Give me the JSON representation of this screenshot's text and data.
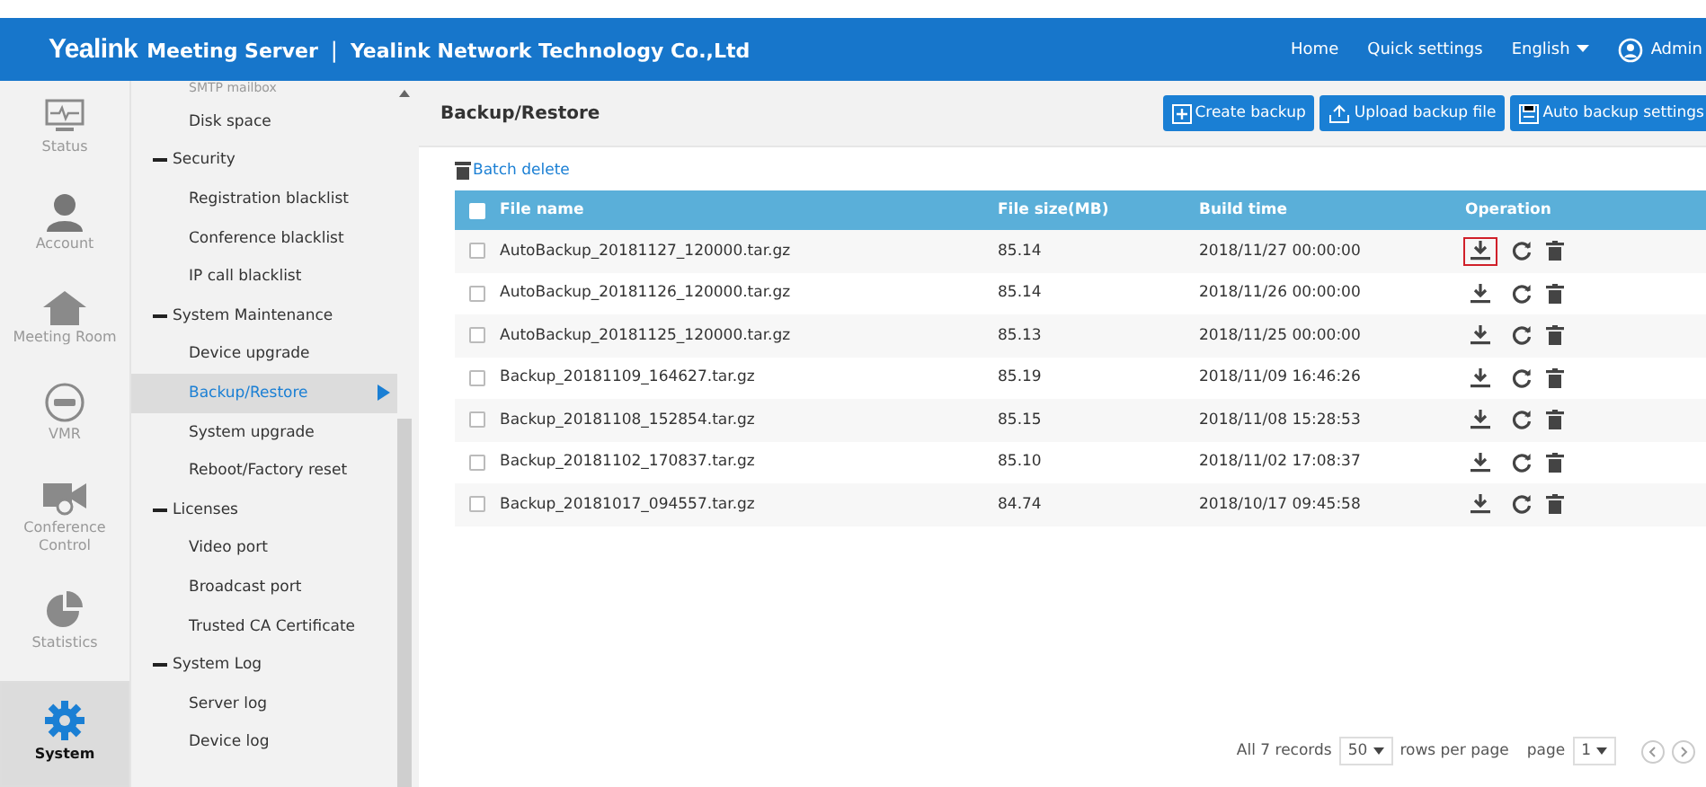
{
  "header": {
    "logo": "Yealink",
    "product": "Meeting Server",
    "separator": "|",
    "company": "Yealink Network Technology Co.,Ltd",
    "links": [
      "Home",
      "Quick settings"
    ],
    "language": "English",
    "user": "Admin"
  },
  "rail": [
    {
      "label": "Status",
      "kind": "monitor",
      "selected": false
    },
    {
      "label": "Account",
      "kind": "person",
      "selected": false
    },
    {
      "label": "Meeting Room",
      "kind": "house",
      "selected": false
    },
    {
      "label": "VMR",
      "kind": "vmr",
      "selected": false
    },
    {
      "label": "Conference Control",
      "kind": "camera",
      "selected": false
    },
    {
      "label": "Statistics",
      "kind": "pie",
      "selected": false
    },
    {
      "label": "System",
      "kind": "gear",
      "selected": true
    }
  ],
  "menu": [
    {
      "kind": "item",
      "label": "SMTP mailbox",
      "selected": false
    },
    {
      "kind": "item",
      "label": "Disk space",
      "selected": false
    },
    {
      "kind": "group",
      "label": "Security",
      "expanded": true
    },
    {
      "kind": "item",
      "label": "Registration blacklist",
      "selected": false
    },
    {
      "kind": "item",
      "label": "Conference blacklist",
      "selected": false
    },
    {
      "kind": "item",
      "label": "IP call blacklist",
      "selected": false
    },
    {
      "kind": "group",
      "label": "System Maintenance",
      "expanded": true
    },
    {
      "kind": "item",
      "label": "Device upgrade",
      "selected": false
    },
    {
      "kind": "item",
      "label": "Backup/Restore",
      "selected": true
    },
    {
      "kind": "item",
      "label": "System upgrade",
      "selected": false
    },
    {
      "kind": "item",
      "label": "Reboot/Factory reset",
      "selected": false
    },
    {
      "kind": "group",
      "label": "Licenses",
      "expanded": true
    },
    {
      "kind": "item",
      "label": "Video port",
      "selected": false
    },
    {
      "kind": "item",
      "label": "Broadcast port",
      "selected": false
    },
    {
      "kind": "item",
      "label": "Trusted CA Certificate",
      "selected": false
    },
    {
      "kind": "group",
      "label": "System Log",
      "expanded": true
    },
    {
      "kind": "item",
      "label": "Server log",
      "selected": false
    },
    {
      "kind": "item",
      "label": "Device log",
      "selected": false
    }
  ],
  "page": {
    "title": "Backup/Restore",
    "buttons": [
      {
        "label": "Create backup",
        "kind": "create"
      },
      {
        "label": "Upload backup file",
        "kind": "upload"
      },
      {
        "label": "Auto backup settings",
        "kind": "settings"
      }
    ],
    "batch_delete": "Batch delete"
  },
  "table": {
    "columns": [
      "File name",
      "File size(MB)",
      "Build time",
      "Operation"
    ],
    "header_checked": false,
    "rows": [
      {
        "name": "AutoBackup_20181127_120000.tar.gz",
        "size": "85.14",
        "time": "2018/11/27 00:00:00",
        "checked": false,
        "highlighted": true
      },
      {
        "name": "AutoBackup_20181126_120000.tar.gz",
        "size": "85.14",
        "time": "2018/11/26 00:00:00",
        "checked": false,
        "highlighted": false
      },
      {
        "name": "AutoBackup_20181125_120000.tar.gz",
        "size": "85.13",
        "time": "2018/11/25 00:00:00",
        "checked": false,
        "highlighted": false
      },
      {
        "name": "Backup_20181109_164627.tar.gz",
        "size": "85.19",
        "time": "2018/11/09 16:46:26",
        "checked": false,
        "highlighted": false
      },
      {
        "name": "Backup_20181108_152854.tar.gz",
        "size": "85.15",
        "time": "2018/11/08 15:28:53",
        "checked": false,
        "highlighted": false
      },
      {
        "name": "Backup_20181102_170837.tar.gz",
        "size": "85.10",
        "time": "2018/11/02 17:08:37",
        "checked": false,
        "highlighted": false
      },
      {
        "name": "Backup_20181017_094557.tar.gz",
        "size": "84.74",
        "time": "2018/10/17 09:45:58",
        "checked": false,
        "highlighted": false
      }
    ]
  },
  "pagination": {
    "total": "All 7 records",
    "page_size": "50",
    "rows_label": "rows per page",
    "page_label": "page",
    "page": "1"
  }
}
